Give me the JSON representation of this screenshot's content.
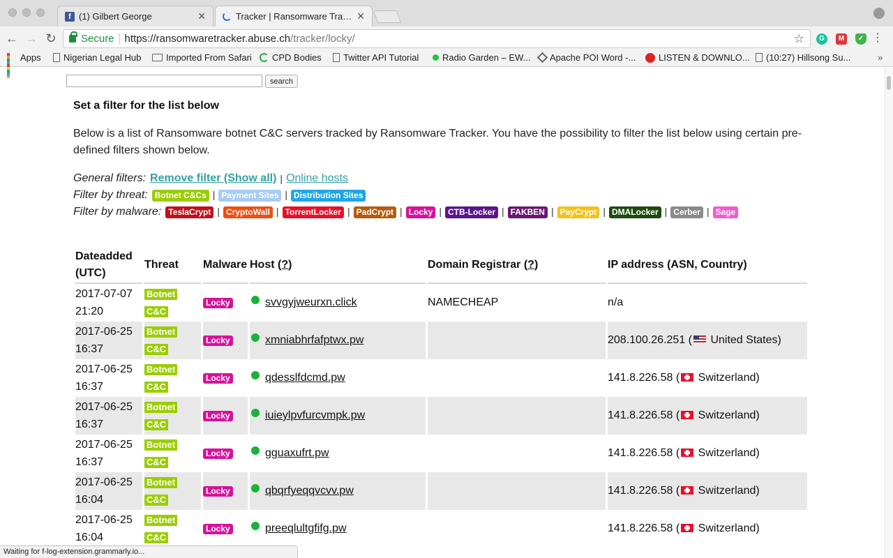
{
  "browser": {
    "tabs": [
      {
        "label": "(1) Gilbert George",
        "icon": "facebook-icon",
        "active": false
      },
      {
        "label": "Tracker | Ransomware Tracker",
        "icon": "loading-spinner-icon",
        "active": true
      }
    ],
    "address": {
      "secure_label": "Secure",
      "url_scheme_host": "https://ransomwaretracker.abuse.ch",
      "url_path": "/tracker/locky/"
    },
    "bookmarks": [
      {
        "label": "Apps",
        "icon": "apps-grid-icon"
      },
      {
        "label": "Nigerian Legal Hub",
        "icon": "page-icon"
      },
      {
        "label": "Imported From Safari",
        "icon": "folder-icon"
      },
      {
        "label": "CPD Bodies",
        "icon": "ring-icon"
      },
      {
        "label": "Twitter API Tutorial",
        "icon": "page-icon"
      },
      {
        "label": "Radio Garden – EW...",
        "icon": "green-dot-icon"
      },
      {
        "label": "Apache POI Word -...",
        "icon": "diamond-icon"
      },
      {
        "label": "LISTEN & DOWNLO...",
        "icon": "red-circle-icon"
      },
      {
        "label": "(10:27) Hillsong Su...",
        "icon": "page-icon"
      }
    ],
    "status_text": "Waiting for f-log-extension.grammarly.io..."
  },
  "page": {
    "search_button": "search",
    "search_value": "",
    "filter_title": "Set a filter for the list below",
    "description": "Below is a list of Ransomware botnet C&C servers tracked by Ransomware Tracker. You have the possibility to filter the list below using certain pre-defined filters shown below.",
    "general_filters": {
      "label": "General filters:",
      "remove": "Remove filter (Show all)",
      "online": "Online hosts"
    },
    "threat_filters": {
      "label": "Filter by threat:",
      "items": [
        {
          "label": "Botnet C&Cs",
          "color": "#9acd00"
        },
        {
          "label": "Payment Sites",
          "color": "#a7cbf3"
        },
        {
          "label": "Distribution Sites",
          "color": "#1fa6e8"
        }
      ]
    },
    "malware_filters": {
      "label": "Filter by malware:",
      "items": [
        {
          "label": "TeslaCrypt",
          "color": "#c0101a"
        },
        {
          "label": "CryptoWall",
          "color": "#f04e12"
        },
        {
          "label": "TorrentLocker",
          "color": "#e8102a"
        },
        {
          "label": "PadCrypt",
          "color": "#b45c0c"
        },
        {
          "label": "Locky",
          "color": "#d6129a"
        },
        {
          "label": "CTB-Locker",
          "color": "#5a168a"
        },
        {
          "label": "FAKBEN",
          "color": "#6b1670"
        },
        {
          "label": "PayCrypt",
          "color": "#f3c21a"
        },
        {
          "label": "DMALocker",
          "color": "#1f4b12"
        },
        {
          "label": "Cerber",
          "color": "#8a8a8a"
        },
        {
          "label": "Sage",
          "color": "#f05ccd"
        }
      ]
    },
    "table": {
      "headers": {
        "date": "Dateadded (UTC)",
        "threat": "Threat",
        "malware": "Malware",
        "host": "Host",
        "host_help": "?",
        "registrar": "Domain Registrar",
        "registrar_help": "?",
        "ip": "IP address (ASN, Country)"
      },
      "rows": [
        {
          "date": "2017-07-07",
          "time": "21:20",
          "threat_a": "Botnet",
          "threat_b": "C&C",
          "malware": "Locky",
          "host": "svvgyjweurxn.click",
          "registrar": "NAMECHEAP",
          "ip": "n/a",
          "flag": "",
          "country": ""
        },
        {
          "date": "2017-06-25",
          "time": "16:37",
          "threat_a": "Botnet",
          "threat_b": "C&C",
          "malware": "Locky",
          "host": "xmniabhrfafptwx.pw",
          "registrar": "",
          "ip": "208.100.26.251",
          "flag": "us",
          "country": "United States"
        },
        {
          "date": "2017-06-25",
          "time": "16:37",
          "threat_a": "Botnet",
          "threat_b": "C&C",
          "malware": "Locky",
          "host": "qdesslfdcmd.pw",
          "registrar": "",
          "ip": "141.8.226.58",
          "flag": "ch",
          "country": "Switzerland"
        },
        {
          "date": "2017-06-25",
          "time": "16:37",
          "threat_a": "Botnet",
          "threat_b": "C&C",
          "malware": "Locky",
          "host": "iuieylpvfurcvmpk.pw",
          "registrar": "",
          "ip": "141.8.226.58",
          "flag": "ch",
          "country": "Switzerland"
        },
        {
          "date": "2017-06-25",
          "time": "16:37",
          "threat_a": "Botnet",
          "threat_b": "C&C",
          "malware": "Locky",
          "host": "gguaxufrt.pw",
          "registrar": "",
          "ip": "141.8.226.58",
          "flag": "ch",
          "country": "Switzerland"
        },
        {
          "date": "2017-06-25",
          "time": "16:04",
          "threat_a": "Botnet",
          "threat_b": "C&C",
          "malware": "Locky",
          "host": "qbqrfyeqqvcvv.pw",
          "registrar": "",
          "ip": "141.8.226.58",
          "flag": "ch",
          "country": "Switzerland"
        },
        {
          "date": "2017-06-25",
          "time": "16:04",
          "threat_a": "Botnet",
          "threat_b": "C&C",
          "malware": "Locky",
          "host": "preeqlultgfifg.pw",
          "registrar": "",
          "ip": "141.8.226.58",
          "flag": "ch",
          "country": "Switzerland"
        }
      ]
    }
  }
}
